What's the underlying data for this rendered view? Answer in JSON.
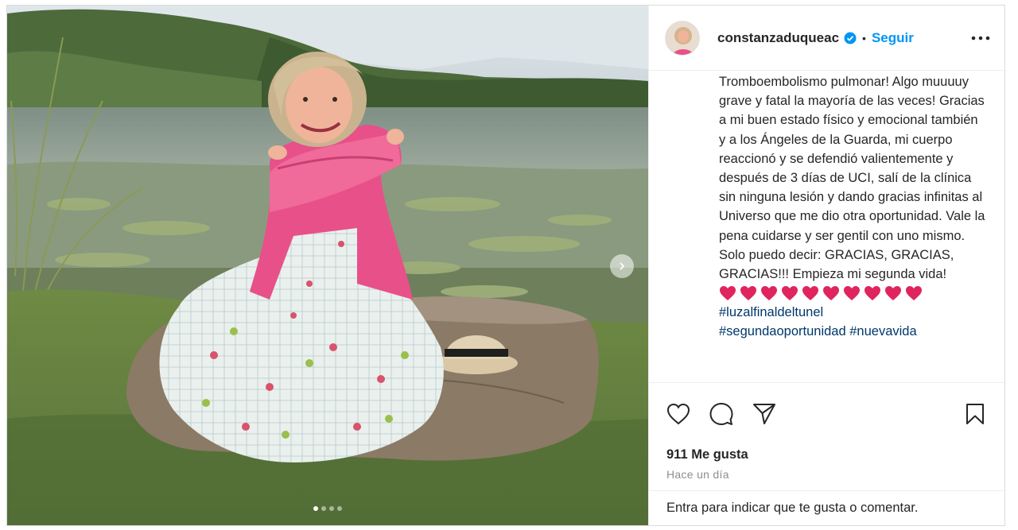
{
  "post": {
    "username": "constanzaduqueac",
    "bullet": "•",
    "follow_label": "Seguir",
    "caption_text": "Tromboembolismo pulmonar! Algo muuuuy grave y fatal la mayoría de las veces! Gracias a mi buen estado físico y emocional también y a los Ángeles de la Guarda, mi cuerpo reaccionó y se defendió valientemente y después de 3 días de UCI, salí de la clínica sin ninguna lesión y dando gracias infinitas al Universo que me dio otra oportunidad. Vale la pena cuidarse y ser gentil con uno mismo. Solo puedo decir: GRACIAS, GRACIAS, GRACIAS!!! Empieza mi segunda vida!",
    "hearts": [
      "❤️",
      "❤️",
      "❤️",
      "❤️",
      "❤️",
      "❤️",
      "❤️",
      "❤️",
      "❤️",
      "❤️"
    ],
    "hashtag_1": "#luzalfinaldeltunel",
    "hashtag_2": "#segundaoportunidad",
    "hashtag_3": "#nuevavida",
    "likes": "911 Me gusta",
    "time": "Hace un día",
    "comment_prompt": "Entra para indicar que te gusta o comentar."
  },
  "media": {
    "carousel_dots": 4,
    "active_dot": 0
  },
  "icons": {
    "verified": "verified-badge-icon",
    "more": "more-options-icon",
    "like": "heart-icon",
    "comment": "comment-icon",
    "share": "share-icon",
    "save": "bookmark-icon",
    "next": "chevron-right-icon"
  },
  "colors": {
    "link_blue": "#0095f6",
    "hashtag": "#00376b",
    "heart_red": "#e0245e",
    "border": "#dbdbdb",
    "muted": "#8e8e8e"
  }
}
